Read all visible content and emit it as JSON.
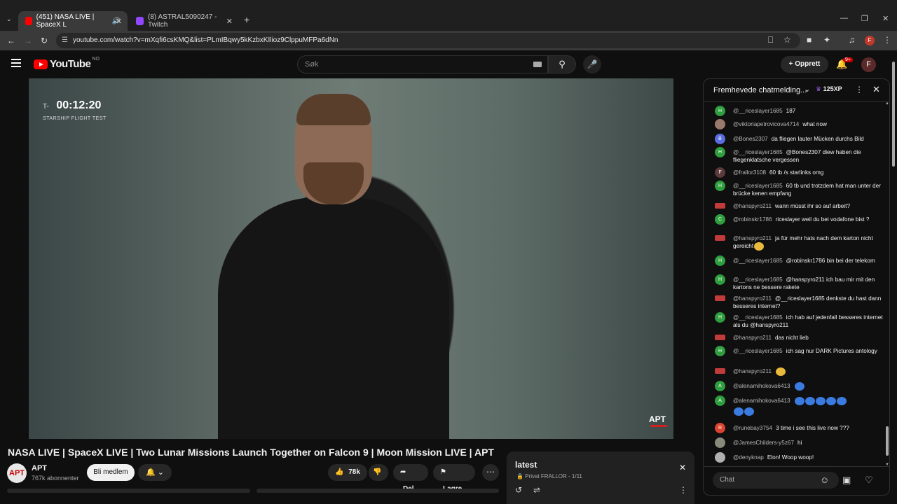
{
  "browser": {
    "tabs": [
      {
        "label": "(451) NASA LIVE | SpaceX L",
        "active": true,
        "favicon_color": "#ff0000"
      },
      {
        "label": "(8) ASTRAL5090247 - Twitch",
        "active": false,
        "favicon_color": "#9146ff"
      }
    ],
    "new_tab": "+",
    "url": "youtube.com/watch?v=mXqfi6csKMQ&list=PLmIBqwy5kKzbxKIlioz9ClppuMFPa6dNn",
    "profile_letter": "F"
  },
  "header": {
    "logo_text": "YouTube",
    "country_code": "NO",
    "search_placeholder": "Søk",
    "create_label": "Opprett",
    "notif_count": "9+",
    "user_letter": "F"
  },
  "video": {
    "countdown_prefix": "T-",
    "countdown": "00:12:20",
    "countdown_sub": "STARSHIP FLIGHT TEST",
    "watermark": "APT",
    "title": "NASA LIVE | SpaceX LIVE | Two Lunar Missions Launch Together on Falcon 9 | Moon Mission LIVE | APT"
  },
  "channel": {
    "avatar_text": "APT",
    "name": "APT",
    "subscribers": "767k abonnenter",
    "join_label": "Bli medlem"
  },
  "actions": {
    "likes": "78k",
    "share": "Del",
    "save": "Lagre"
  },
  "playlist": {
    "title": "latest",
    "privacy": "Privat",
    "owner_progress": "FRALLOR - 1/11"
  },
  "chat": {
    "header_title": "Fremhevede chatmelding...",
    "xp": "125XP",
    "input_placeholder": "Chat",
    "messages": [
      {
        "avatar": "H",
        "color": "#2e9e3f",
        "user": "@__riceslayer1685",
        "text": "187"
      },
      {
        "avatar": "",
        "color": "#9a7a6a",
        "user": "@viktoriapetrovicova4714",
        "text": "what now"
      },
      {
        "avatar": "B",
        "color": "#5b6ee1",
        "user": "@Bones2307",
        "text": "da fliegen lauter Mücken durchs Bild"
      },
      {
        "avatar": "H",
        "color": "#2e9e3f",
        "user": "@__riceslayer1685",
        "text": "@Bones2307 diew haben die fliegenklatsche vergessen"
      },
      {
        "avatar": "F",
        "color": "#5a3a3a",
        "user": "@frallor3108",
        "text": "60 tb /s starlinks omg"
      },
      {
        "avatar": "H",
        "color": "#2e9e3f",
        "user": "@__riceslayer1685",
        "text": "60 tb und trotzdem hat man unter der brücke kenen empfang"
      },
      {
        "avatar": "",
        "color": "#c23b3b",
        "user": "@hanspyro211",
        "text": "wann müsst ihr so auf arbeit?"
      },
      {
        "avatar": "C",
        "color": "#2e9e3f",
        "user": "@robinskr1786",
        "text": "riceslayer weil du bei vodafone bist ?"
      },
      {
        "avatar": "",
        "color": "#c23b3b",
        "user": "@hanspyro211",
        "text": "ja für mehr hats nach dem karton nicht gereicht"
      },
      {
        "avatar": "H",
        "color": "#2e9e3f",
        "user": "@__riceslayer1685",
        "text": "@robinskr1786 bin bei der telekom"
      },
      {
        "avatar": "H",
        "color": "#2e9e3f",
        "user": "@__riceslayer1685",
        "text": "@hanspyro211 ich bau mir mit den kartons ne bessere rakete"
      },
      {
        "avatar": "",
        "color": "#c23b3b",
        "user": "@hanspyro211",
        "text": "@__riceslayer1685 denkste du hast dann besseres internet?"
      },
      {
        "avatar": "H",
        "color": "#2e9e3f",
        "user": "@__riceslayer1685",
        "text": "ich hab auf jedenfall besseres internet als du @hanspyro211"
      },
      {
        "avatar": "",
        "color": "#c23b3b",
        "user": "@hanspyro211",
        "text": "das nicht lieb"
      },
      {
        "avatar": "H",
        "color": "#2e9e3f",
        "user": "@__riceslayer1685",
        "text": "ich sag nur DARK Pictures antology"
      },
      {
        "avatar": "",
        "color": "#c23b3b",
        "user": "@hanspyro211",
        "text": ""
      },
      {
        "avatar": "A",
        "color": "#2e9e3f",
        "user": "@alenamihokova6413",
        "text": ""
      },
      {
        "avatar": "A",
        "color": "#2e9e3f",
        "user": "@alenamihokova6413",
        "text": ""
      },
      {
        "avatar": "R",
        "color": "#d9432f",
        "user": "@runebay3754",
        "text": "3 time i see this live now ???"
      },
      {
        "avatar": "",
        "color": "#8a8a7a",
        "user": "@JamesChilders-y5z67",
        "text": "hi"
      },
      {
        "avatar": "",
        "color": "#b0b0b0",
        "user": "@denyknap",
        "text": "Elon! Woop woop!"
      }
    ]
  }
}
